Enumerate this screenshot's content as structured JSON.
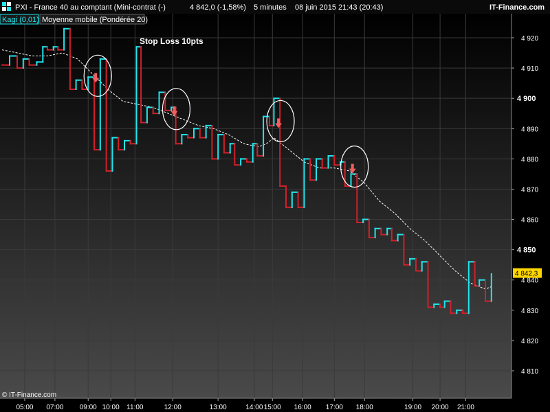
{
  "header": {
    "instrument": "PXI - France 40 au comptant (Mini-contrat  (-)",
    "last_info": "4 842,0 (-1,58%)",
    "timeframe": "5 minutes",
    "datetime": "08 juin 2015 21:43 (20:43)",
    "brand": "IT-Finance.com"
  },
  "legend": {
    "kagi_label": "Kagi (0,01)",
    "ma_label": "Moyenne mobile (Pondérée 20)"
  },
  "annotation": {
    "text": "Stop Loss 10pts"
  },
  "copyright": "© IT-Finance.com",
  "last_price": {
    "label": "4 842,3",
    "value": 4842.3
  },
  "colors": {
    "bull": "#22e5ee",
    "bear": "#d0202a",
    "ma": "#ffffff",
    "grid": "#3a3a3a",
    "label_bg": "#ffd700",
    "arrow": "#f06060"
  },
  "chart_data": {
    "type": "line",
    "title": "PXI - France 40 au comptant (Mini-contrat  (-)",
    "xlabel": "",
    "ylabel": "",
    "ylim": [
      4800,
      4925
    ],
    "grid": true,
    "legend_position": "top-left",
    "y_ticks": [
      {
        "value": 4920,
        "label": "4 920",
        "bold": false
      },
      {
        "value": 4910,
        "label": "4 910",
        "bold": false
      },
      {
        "value": 4900,
        "label": "4 900",
        "bold": true
      },
      {
        "value": 4890,
        "label": "4 890",
        "bold": false
      },
      {
        "value": 4880,
        "label": "4 880",
        "bold": false
      },
      {
        "value": 4870,
        "label": "4 870",
        "bold": false
      },
      {
        "value": 4860,
        "label": "4 860",
        "bold": false
      },
      {
        "value": 4850,
        "label": "4 850",
        "bold": true
      },
      {
        "value": 4840,
        "label": "4 840",
        "bold": false
      },
      {
        "value": 4830,
        "label": "4 830",
        "bold": false
      },
      {
        "value": 4820,
        "label": "4 820",
        "bold": false
      },
      {
        "value": 4810,
        "label": "4 810",
        "bold": false
      }
    ],
    "x_ticks": [
      "05:00",
      "07:00",
      "09:00",
      "10:00",
      "11:00",
      "12:00",
      "13:00",
      "14:00",
      "15:00",
      "16:00",
      "17:00",
      "18:00",
      "19:00",
      "20:00",
      "21:00"
    ],
    "x_ticks_index": [
      1.5,
      3.5,
      5.7,
      7.2,
      8.8,
      11.3,
      14.3,
      16.7,
      17.9,
      19.9,
      22.0,
      24.0,
      27.2,
      29.0,
      30.7
    ],
    "kagi": [
      {
        "x": 0.0,
        "y": 4911
      },
      {
        "x": 0.5,
        "y": 4911
      },
      {
        "x": 0.5,
        "y": 4914
      },
      {
        "x": 1.0,
        "y": 4914
      },
      {
        "x": 1.0,
        "y": 4910
      },
      {
        "x": 1.4,
        "y": 4910
      },
      {
        "x": 1.4,
        "y": 4913
      },
      {
        "x": 1.8,
        "y": 4913
      },
      {
        "x": 1.8,
        "y": 4911
      },
      {
        "x": 2.3,
        "y": 4911
      },
      {
        "x": 2.3,
        "y": 4912
      },
      {
        "x": 2.7,
        "y": 4912
      },
      {
        "x": 2.7,
        "y": 4917
      },
      {
        "x": 3.0,
        "y": 4917
      },
      {
        "x": 3.0,
        "y": 4916
      },
      {
        "x": 3.4,
        "y": 4916
      },
      {
        "x": 3.4,
        "y": 4917
      },
      {
        "x": 3.7,
        "y": 4917
      },
      {
        "x": 3.7,
        "y": 4916
      },
      {
        "x": 4.1,
        "y": 4916
      },
      {
        "x": 4.1,
        "y": 4923
      },
      {
        "x": 4.5,
        "y": 4923
      },
      {
        "x": 4.5,
        "y": 4903
      },
      {
        "x": 4.9,
        "y": 4903
      },
      {
        "x": 4.9,
        "y": 4906
      },
      {
        "x": 5.3,
        "y": 4906
      },
      {
        "x": 5.3,
        "y": 4903
      },
      {
        "x": 5.7,
        "y": 4903
      },
      {
        "x": 5.7,
        "y": 4907
      },
      {
        "x": 6.1,
        "y": 4907
      },
      {
        "x": 6.1,
        "y": 4883
      },
      {
        "x": 6.5,
        "y": 4883
      },
      {
        "x": 6.5,
        "y": 4913
      },
      {
        "x": 6.9,
        "y": 4913
      },
      {
        "x": 6.9,
        "y": 4876
      },
      {
        "x": 7.3,
        "y": 4876
      },
      {
        "x": 7.3,
        "y": 4887
      },
      {
        "x": 7.7,
        "y": 4887
      },
      {
        "x": 7.7,
        "y": 4883
      },
      {
        "x": 8.1,
        "y": 4883
      },
      {
        "x": 8.1,
        "y": 4886
      },
      {
        "x": 8.5,
        "y": 4886
      },
      {
        "x": 8.5,
        "y": 4885
      },
      {
        "x": 8.9,
        "y": 4885
      },
      {
        "x": 8.9,
        "y": 4917
      },
      {
        "x": 9.2,
        "y": 4917
      },
      {
        "x": 9.2,
        "y": 4892
      },
      {
        "x": 9.6,
        "y": 4892
      },
      {
        "x": 9.6,
        "y": 4897
      },
      {
        "x": 10.0,
        "y": 4897
      },
      {
        "x": 10.0,
        "y": 4895
      },
      {
        "x": 10.4,
        "y": 4895
      },
      {
        "x": 10.4,
        "y": 4902
      },
      {
        "x": 10.8,
        "y": 4902
      },
      {
        "x": 10.8,
        "y": 4896
      },
      {
        "x": 11.2,
        "y": 4896
      },
      {
        "x": 11.2,
        "y": 4897
      },
      {
        "x": 11.5,
        "y": 4897
      },
      {
        "x": 11.5,
        "y": 4885
      },
      {
        "x": 11.9,
        "y": 4885
      },
      {
        "x": 11.9,
        "y": 4888
      },
      {
        "x": 12.3,
        "y": 4888
      },
      {
        "x": 12.3,
        "y": 4887
      },
      {
        "x": 12.7,
        "y": 4887
      },
      {
        "x": 12.7,
        "y": 4890
      },
      {
        "x": 13.1,
        "y": 4890
      },
      {
        "x": 13.1,
        "y": 4887
      },
      {
        "x": 13.5,
        "y": 4887
      },
      {
        "x": 13.5,
        "y": 4891
      },
      {
        "x": 13.9,
        "y": 4891
      },
      {
        "x": 13.9,
        "y": 4880
      },
      {
        "x": 14.3,
        "y": 4880
      },
      {
        "x": 14.3,
        "y": 4888
      },
      {
        "x": 14.7,
        "y": 4888
      },
      {
        "x": 14.7,
        "y": 4882
      },
      {
        "x": 15.1,
        "y": 4882
      },
      {
        "x": 15.1,
        "y": 4885
      },
      {
        "x": 15.4,
        "y": 4885
      },
      {
        "x": 15.4,
        "y": 4878
      },
      {
        "x": 15.8,
        "y": 4878
      },
      {
        "x": 15.8,
        "y": 4880
      },
      {
        "x": 16.2,
        "y": 4880
      },
      {
        "x": 16.2,
        "y": 4879
      },
      {
        "x": 16.6,
        "y": 4879
      },
      {
        "x": 16.6,
        "y": 4885
      },
      {
        "x": 16.9,
        "y": 4885
      },
      {
        "x": 16.9,
        "y": 4881
      },
      {
        "x": 17.3,
        "y": 4881
      },
      {
        "x": 17.3,
        "y": 4894
      },
      {
        "x": 17.7,
        "y": 4894
      },
      {
        "x": 17.7,
        "y": 4891
      },
      {
        "x": 18.0,
        "y": 4891
      },
      {
        "x": 18.0,
        "y": 4900
      },
      {
        "x": 18.4,
        "y": 4900
      },
      {
        "x": 18.4,
        "y": 4871
      },
      {
        "x": 18.8,
        "y": 4871
      },
      {
        "x": 18.8,
        "y": 4864
      },
      {
        "x": 19.2,
        "y": 4864
      },
      {
        "x": 19.2,
        "y": 4869
      },
      {
        "x": 19.6,
        "y": 4869
      },
      {
        "x": 19.6,
        "y": 4864
      },
      {
        "x": 20.0,
        "y": 4864
      },
      {
        "x": 20.0,
        "y": 4880
      },
      {
        "x": 20.4,
        "y": 4880
      },
      {
        "x": 20.4,
        "y": 4873
      },
      {
        "x": 20.8,
        "y": 4873
      },
      {
        "x": 20.8,
        "y": 4880
      },
      {
        "x": 21.2,
        "y": 4880
      },
      {
        "x": 21.2,
        "y": 4877
      },
      {
        "x": 21.6,
        "y": 4877
      },
      {
        "x": 21.6,
        "y": 4881
      },
      {
        "x": 22.0,
        "y": 4881
      },
      {
        "x": 22.0,
        "y": 4878
      },
      {
        "x": 22.4,
        "y": 4878
      },
      {
        "x": 22.4,
        "y": 4879
      },
      {
        "x": 22.7,
        "y": 4879
      },
      {
        "x": 22.7,
        "y": 4871
      },
      {
        "x": 23.1,
        "y": 4871
      },
      {
        "x": 23.1,
        "y": 4875
      },
      {
        "x": 23.5,
        "y": 4875
      },
      {
        "x": 23.5,
        "y": 4859
      },
      {
        "x": 23.9,
        "y": 4859
      },
      {
        "x": 23.9,
        "y": 4860
      },
      {
        "x": 24.3,
        "y": 4860
      },
      {
        "x": 24.3,
        "y": 4854
      },
      {
        "x": 24.7,
        "y": 4854
      },
      {
        "x": 24.7,
        "y": 4857
      },
      {
        "x": 25.1,
        "y": 4857
      },
      {
        "x": 25.1,
        "y": 4855
      },
      {
        "x": 25.5,
        "y": 4855
      },
      {
        "x": 25.5,
        "y": 4857
      },
      {
        "x": 25.8,
        "y": 4857
      },
      {
        "x": 25.8,
        "y": 4853
      },
      {
        "x": 26.2,
        "y": 4853
      },
      {
        "x": 26.2,
        "y": 4855
      },
      {
        "x": 26.6,
        "y": 4855
      },
      {
        "x": 26.6,
        "y": 4845
      },
      {
        "x": 27.0,
        "y": 4845
      },
      {
        "x": 27.0,
        "y": 4847
      },
      {
        "x": 27.4,
        "y": 4847
      },
      {
        "x": 27.4,
        "y": 4843
      },
      {
        "x": 27.8,
        "y": 4843
      },
      {
        "x": 27.8,
        "y": 4846
      },
      {
        "x": 28.2,
        "y": 4846
      },
      {
        "x": 28.2,
        "y": 4831
      },
      {
        "x": 28.6,
        "y": 4831
      },
      {
        "x": 28.6,
        "y": 4832
      },
      {
        "x": 29.0,
        "y": 4832
      },
      {
        "x": 29.0,
        "y": 4831
      },
      {
        "x": 29.3,
        "y": 4831
      },
      {
        "x": 29.3,
        "y": 4833
      },
      {
        "x": 29.7,
        "y": 4833
      },
      {
        "x": 29.7,
        "y": 4829
      },
      {
        "x": 30.1,
        "y": 4829
      },
      {
        "x": 30.1,
        "y": 4830
      },
      {
        "x": 30.5,
        "y": 4830
      },
      {
        "x": 30.5,
        "y": 4829
      },
      {
        "x": 30.9,
        "y": 4829
      },
      {
        "x": 30.9,
        "y": 4846
      },
      {
        "x": 31.3,
        "y": 4846
      },
      {
        "x": 31.3,
        "y": 4838
      },
      {
        "x": 31.6,
        "y": 4838
      },
      {
        "x": 31.6,
        "y": 4840
      },
      {
        "x": 32.0,
        "y": 4840
      },
      {
        "x": 32.0,
        "y": 4833
      },
      {
        "x": 32.4,
        "y": 4833
      },
      {
        "x": 32.4,
        "y": 4842
      }
    ],
    "ma": [
      {
        "x": 0.0,
        "y": 4916
      },
      {
        "x": 1.0,
        "y": 4915
      },
      {
        "x": 2.0,
        "y": 4914
      },
      {
        "x": 3.0,
        "y": 4914
      },
      {
        "x": 4.0,
        "y": 4915
      },
      {
        "x": 5.0,
        "y": 4913
      },
      {
        "x": 6.0,
        "y": 4908
      },
      {
        "x": 7.0,
        "y": 4903
      },
      {
        "x": 8.0,
        "y": 4899
      },
      {
        "x": 9.0,
        "y": 4898
      },
      {
        "x": 10.0,
        "y": 4897
      },
      {
        "x": 11.0,
        "y": 4895
      },
      {
        "x": 12.0,
        "y": 4893
      },
      {
        "x": 13.0,
        "y": 4891
      },
      {
        "x": 14.0,
        "y": 4890
      },
      {
        "x": 15.0,
        "y": 4888
      },
      {
        "x": 16.0,
        "y": 4885
      },
      {
        "x": 17.0,
        "y": 4884
      },
      {
        "x": 17.5,
        "y": 4885
      },
      {
        "x": 18.0,
        "y": 4887
      },
      {
        "x": 19.0,
        "y": 4883
      },
      {
        "x": 20.0,
        "y": 4879
      },
      {
        "x": 21.0,
        "y": 4877
      },
      {
        "x": 22.0,
        "y": 4877
      },
      {
        "x": 23.0,
        "y": 4876
      },
      {
        "x": 24.0,
        "y": 4872
      },
      {
        "x": 25.0,
        "y": 4866
      },
      {
        "x": 26.0,
        "y": 4862
      },
      {
        "x": 27.0,
        "y": 4857
      },
      {
        "x": 28.0,
        "y": 4853
      },
      {
        "x": 29.0,
        "y": 4848
      },
      {
        "x": 30.0,
        "y": 4843
      },
      {
        "x": 31.0,
        "y": 4839
      },
      {
        "x": 32.0,
        "y": 4837
      },
      {
        "x": 32.5,
        "y": 4838
      }
    ],
    "stop_markers": [
      {
        "x": 6.2,
        "y": 4907
      },
      {
        "x": 11.4,
        "y": 4896
      },
      {
        "x": 18.3,
        "y": 4892
      },
      {
        "x": 23.2,
        "y": 4877
      }
    ]
  }
}
